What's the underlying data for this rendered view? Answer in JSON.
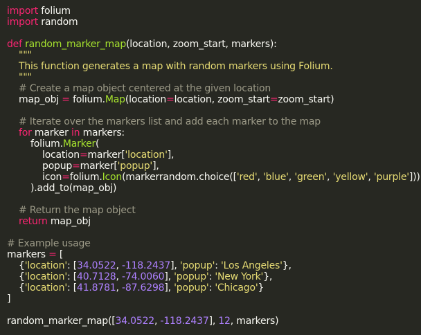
{
  "code": {
    "lines": [
      [
        {
          "t": "import",
          "c": "kw"
        },
        {
          "t": " folium",
          "c": "plain"
        }
      ],
      [
        {
          "t": "import",
          "c": "kw"
        },
        {
          "t": " random",
          "c": "plain"
        }
      ],
      [],
      [
        {
          "t": "def ",
          "c": "kw"
        },
        {
          "t": "random_marker_map",
          "c": "fn"
        },
        {
          "t": "(location, zoom_start, markers):",
          "c": "plain"
        }
      ],
      [
        {
          "t": "    \"\"\"",
          "c": "str"
        }
      ],
      [
        {
          "t": "    This function generates a map with random markers using Folium.",
          "c": "str"
        }
      ],
      [
        {
          "t": "    \"\"\"",
          "c": "str"
        }
      ],
      [
        {
          "t": "    # Create a map object centered at the given location",
          "c": "com"
        }
      ],
      [
        {
          "t": "    map_obj ",
          "c": "plain"
        },
        {
          "t": "=",
          "c": "op"
        },
        {
          "t": " folium.",
          "c": "plain"
        },
        {
          "t": "Map",
          "c": "cls"
        },
        {
          "t": "(location",
          "c": "plain"
        },
        {
          "t": "=",
          "c": "op"
        },
        {
          "t": "location, zoom_start",
          "c": "plain"
        },
        {
          "t": "=",
          "c": "op"
        },
        {
          "t": "zoom_start)",
          "c": "plain"
        }
      ],
      [],
      [
        {
          "t": "    # Iterate over the markers list and add each marker to the map",
          "c": "com"
        }
      ],
      [
        {
          "t": "    ",
          "c": "plain"
        },
        {
          "t": "for",
          "c": "kw"
        },
        {
          "t": " marker ",
          "c": "plain"
        },
        {
          "t": "in",
          "c": "kw"
        },
        {
          "t": " markers:",
          "c": "plain"
        }
      ],
      [
        {
          "t": "        folium.",
          "c": "plain"
        },
        {
          "t": "Marker",
          "c": "cls"
        },
        {
          "t": "(",
          "c": "plain"
        }
      ],
      [
        {
          "t": "            location",
          "c": "plain"
        },
        {
          "t": "=",
          "c": "op"
        },
        {
          "t": "marker[",
          "c": "plain"
        },
        {
          "t": "'location'",
          "c": "str"
        },
        {
          "t": "],",
          "c": "plain"
        }
      ],
      [
        {
          "t": "            popup",
          "c": "plain"
        },
        {
          "t": "=",
          "c": "op"
        },
        {
          "t": "marker[",
          "c": "plain"
        },
        {
          "t": "'popup'",
          "c": "str"
        },
        {
          "t": "],",
          "c": "plain"
        }
      ],
      [
        {
          "t": "            icon",
          "c": "plain"
        },
        {
          "t": "=",
          "c": "op"
        },
        {
          "t": "folium.",
          "c": "plain"
        },
        {
          "t": "Icon",
          "c": "cls"
        },
        {
          "t": "(markerrandom.choice([",
          "c": "plain"
        },
        {
          "t": "'red'",
          "c": "str"
        },
        {
          "t": ", ",
          "c": "plain"
        },
        {
          "t": "'blue'",
          "c": "str"
        },
        {
          "t": ", ",
          "c": "plain"
        },
        {
          "t": "'green'",
          "c": "str"
        },
        {
          "t": ", ",
          "c": "plain"
        },
        {
          "t": "'yellow'",
          "c": "str"
        },
        {
          "t": ", ",
          "c": "plain"
        },
        {
          "t": "'purple'",
          "c": "str"
        },
        {
          "t": "]))",
          "c": "plain"
        }
      ],
      [
        {
          "t": "        ).add_to(map_obj)",
          "c": "plain"
        }
      ],
      [],
      [
        {
          "t": "    # Return the map object",
          "c": "com"
        }
      ],
      [
        {
          "t": "    ",
          "c": "plain"
        },
        {
          "t": "return",
          "c": "kw"
        },
        {
          "t": " map_obj",
          "c": "plain"
        }
      ],
      [],
      [
        {
          "t": "# Example usage",
          "c": "com"
        }
      ],
      [
        {
          "t": "markers ",
          "c": "plain"
        },
        {
          "t": "=",
          "c": "op"
        },
        {
          "t": " [",
          "c": "plain"
        }
      ],
      [
        {
          "t": "    {",
          "c": "plain"
        },
        {
          "t": "'location'",
          "c": "str"
        },
        {
          "t": ": [",
          "c": "plain"
        },
        {
          "t": "34.0522",
          "c": "num"
        },
        {
          "t": ", ",
          "c": "plain"
        },
        {
          "t": "-118.2437",
          "c": "num"
        },
        {
          "t": "], ",
          "c": "plain"
        },
        {
          "t": "'popup'",
          "c": "str"
        },
        {
          "t": ": ",
          "c": "plain"
        },
        {
          "t": "'Los Angeles'",
          "c": "str"
        },
        {
          "t": "},",
          "c": "plain"
        }
      ],
      [
        {
          "t": "    {",
          "c": "plain"
        },
        {
          "t": "'location'",
          "c": "str"
        },
        {
          "t": ": [",
          "c": "plain"
        },
        {
          "t": "40.7128",
          "c": "num"
        },
        {
          "t": ", ",
          "c": "plain"
        },
        {
          "t": "-74.0060",
          "c": "num"
        },
        {
          "t": "], ",
          "c": "plain"
        },
        {
          "t": "'popup'",
          "c": "str"
        },
        {
          "t": ": ",
          "c": "plain"
        },
        {
          "t": "'New York'",
          "c": "str"
        },
        {
          "t": "},",
          "c": "plain"
        }
      ],
      [
        {
          "t": "    {",
          "c": "plain"
        },
        {
          "t": "'location'",
          "c": "str"
        },
        {
          "t": ": [",
          "c": "plain"
        },
        {
          "t": "41.8781",
          "c": "num"
        },
        {
          "t": ", ",
          "c": "plain"
        },
        {
          "t": "-87.6298",
          "c": "num"
        },
        {
          "t": "], ",
          "c": "plain"
        },
        {
          "t": "'popup'",
          "c": "str"
        },
        {
          "t": ": ",
          "c": "plain"
        },
        {
          "t": "'Chicago'",
          "c": "str"
        },
        {
          "t": "}",
          "c": "plain"
        }
      ],
      [
        {
          "t": "]",
          "c": "plain"
        }
      ],
      [],
      [
        {
          "t": "random_marker_map([",
          "c": "plain"
        },
        {
          "t": "34.0522",
          "c": "num"
        },
        {
          "t": ", ",
          "c": "plain"
        },
        {
          "t": "-118.2437",
          "c": "num"
        },
        {
          "t": "], ",
          "c": "plain"
        },
        {
          "t": "12",
          "c": "num"
        },
        {
          "t": ", markers)",
          "c": "plain"
        }
      ]
    ]
  },
  "theme": {
    "background": "#272822",
    "keyword": "#f92672",
    "function": "#a6e22e",
    "string": "#e6db74",
    "number": "#ae81ff",
    "comment": "#9c9a87",
    "text": "#f8f8f2"
  }
}
